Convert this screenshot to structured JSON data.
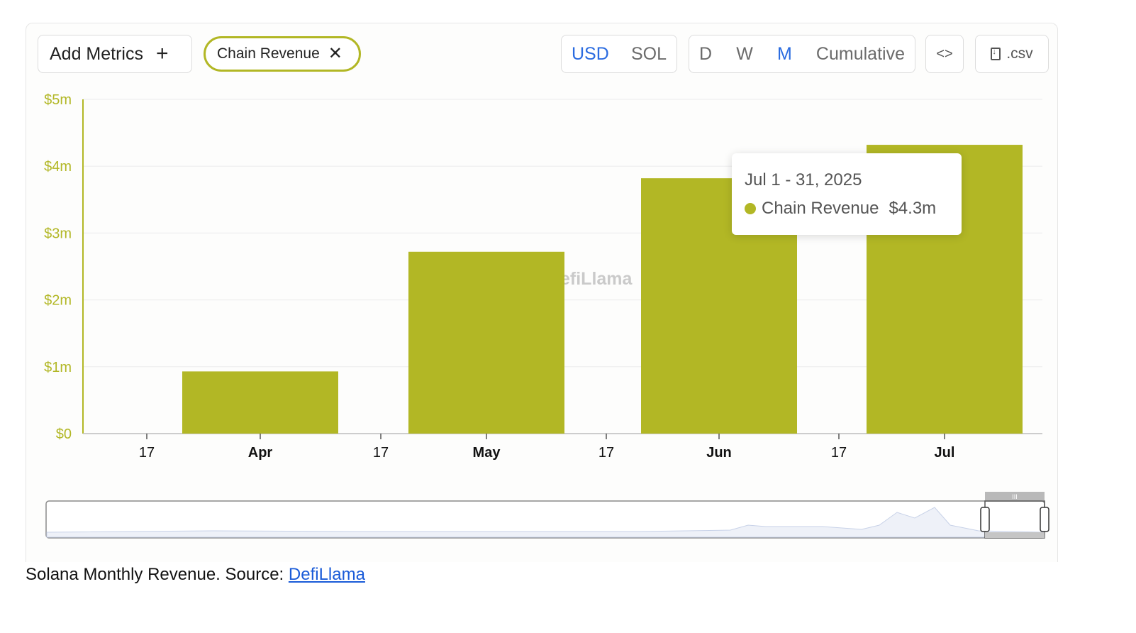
{
  "toolbar": {
    "add_metrics_label": "Add Metrics",
    "chip_label": "Chain Revenue",
    "units": [
      "USD",
      "SOL"
    ],
    "active_unit": "USD",
    "periods": [
      "D",
      "W",
      "M",
      "Cumulative"
    ],
    "active_period": "M",
    "embed_label": "<>",
    "csv_label": ".csv"
  },
  "watermark": "efiLlama",
  "colors": {
    "bar": "#b2b725",
    "axis": "#b2b725",
    "active": "#2a6be0"
  },
  "chart_data": {
    "type": "bar",
    "categories": [
      "Apr",
      "May",
      "Jun",
      "Jul"
    ],
    "series": [
      {
        "name": "Chain Revenue",
        "values": [
          0.93,
          2.72,
          3.82,
          4.32
        ]
      }
    ],
    "ylim": [
      0,
      5
    ],
    "yticks": [
      "$0",
      "$1m",
      "$2m",
      "$3m",
      "$4m",
      "$5m"
    ],
    "xticks": [
      "17",
      "Apr",
      "17",
      "May",
      "17",
      "Jun",
      "17",
      "Jul"
    ],
    "grid": true
  },
  "tooltip": {
    "date": "Jul 1 - 31, 2025",
    "series": "Chain Revenue",
    "value": "$4.3m"
  },
  "caption": {
    "text": "Solana Monthly Revenue. Source: ",
    "link": "DefiLlama"
  }
}
